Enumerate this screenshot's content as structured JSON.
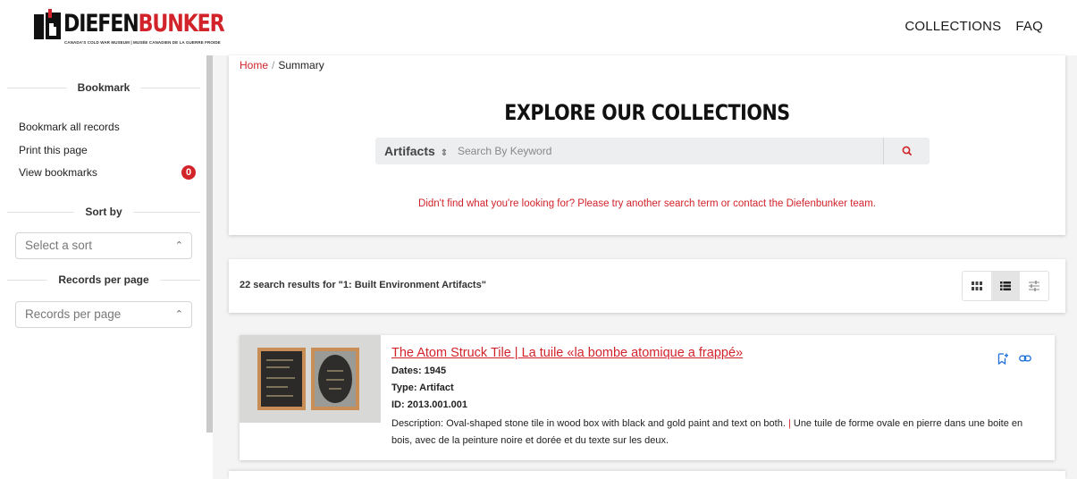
{
  "brand": {
    "name_prefix": "DIEFEN",
    "name_suffix": "BUNKER",
    "tagline": "CANADA'S COLD WAR MUSEUM | MUSÉE CANADIEN DE LA GUERRE FROIDE",
    "accent_color": "#d2232a"
  },
  "nav": {
    "items": [
      {
        "label": "COLLECTIONS"
      },
      {
        "label": "FAQ"
      }
    ]
  },
  "sidebar": {
    "bookmark_heading": "Bookmark",
    "bookmark_all": "Bookmark all records",
    "print_page": "Print this page",
    "view_bookmarks": "View bookmarks",
    "bookmark_count": "0",
    "sort_heading": "Sort by",
    "sort_placeholder": "Select a sort",
    "records_heading": "Records per page",
    "records_placeholder": "Records per page"
  },
  "breadcrumb": {
    "home": "Home",
    "separator": "/",
    "current": "Summary"
  },
  "search": {
    "title": "EXPLORE OUR COLLECTIONS",
    "type_label": "Artifacts",
    "placeholder": "Search By Keyword",
    "help_text": "Didn't find what you're looking for? Please try another search term or contact the Diefenbunker team."
  },
  "results": {
    "summary": "22 search results for \"1: Built Environment Artifacts\"",
    "view_modes": [
      "grid-icon",
      "list-icon",
      "filter-icon"
    ],
    "active_view": "list-icon"
  },
  "items": [
    {
      "title": "The Atom Struck Tile | La tuile «la bombe atomique a frappé»",
      "dates": "Dates: 1945",
      "type": "Type: Artifact",
      "id": "ID: 2013.001.001",
      "desc_label": "Description:",
      "desc_en": "Oval-shaped stone tile in wood box with black and gold paint and text on both.",
      "desc_sep": "|",
      "desc_fr": "Une tuile de forme ovale en pierre dans une boite en bois, avec de la peinture noire et dorée et du texte sur les deux."
    }
  ]
}
